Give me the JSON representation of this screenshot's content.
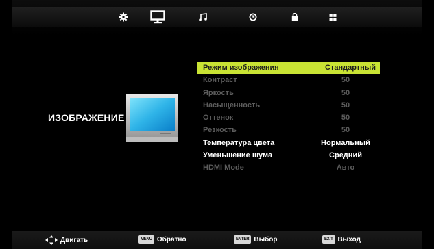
{
  "colors": {
    "accent": "#c9e334",
    "text": "#ffffff",
    "dim": "#5c5c5c"
  },
  "tabs": [
    {
      "icon": "gear-icon",
      "active": false
    },
    {
      "icon": "monitor-icon",
      "active": true
    },
    {
      "icon": "music-note-icon",
      "active": false
    },
    {
      "icon": "clock-icon",
      "active": false
    },
    {
      "icon": "lock-icon",
      "active": false
    },
    {
      "icon": "grid-icon",
      "active": false
    }
  ],
  "section": {
    "title": "ИЗОБРАЖЕНИЕ",
    "icon": "tv-icon"
  },
  "menu": [
    {
      "label": "Режим изображения",
      "value": "Стандартный",
      "state": "selected"
    },
    {
      "label": "Контраст",
      "value": "50",
      "state": "dim"
    },
    {
      "label": "Яркость",
      "value": "50",
      "state": "dim"
    },
    {
      "label": "Насыщенность",
      "value": "50",
      "state": "dim"
    },
    {
      "label": "Оттенок",
      "value": "50",
      "state": "dim"
    },
    {
      "label": "Резкость",
      "value": "50",
      "state": "dim"
    },
    {
      "label": "Температура цвета",
      "value": "Нормальный",
      "state": "normal"
    },
    {
      "label": "Уменьшение шума",
      "value": "Средний",
      "state": "normal"
    },
    {
      "label": "HDMI Mode",
      "value": "Авто",
      "state": "dim"
    }
  ],
  "footer": {
    "move": {
      "label": "Двигать",
      "icon": "dpad-icon"
    },
    "back": {
      "key": "MENU",
      "label": "Обратно"
    },
    "select": {
      "key": "ENTER",
      "label": "Выбор"
    },
    "exit": {
      "key": "EXIT",
      "label": "Выход"
    }
  }
}
